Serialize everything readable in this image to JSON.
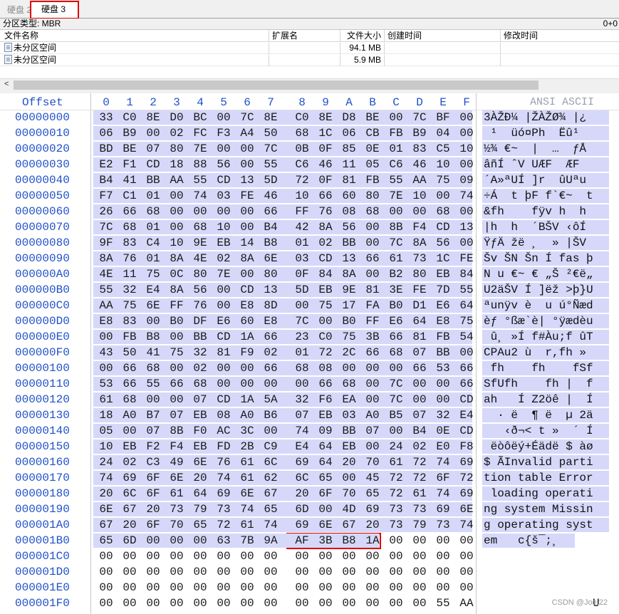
{
  "tabs": [
    {
      "label": "硬盘 2"
    },
    {
      "label": "硬盘 3"
    }
  ],
  "partition_bar": {
    "label": "分区类型: MBR",
    "right_value": "0+0"
  },
  "file_table": {
    "columns": [
      "文件名称",
      "扩展名",
      "文件大小",
      "创建时间",
      "修改时间"
    ],
    "rows": [
      {
        "name": "未分区空间",
        "ext": "",
        "size": "94.1 MB",
        "created": "",
        "modified": ""
      },
      {
        "name": "未分区空间",
        "ext": "",
        "size": "5.9 MB",
        "created": "",
        "modified": ""
      }
    ]
  },
  "hex_view": {
    "offset_header": "Offset",
    "column_headers": [
      "0",
      "1",
      "2",
      "3",
      "4",
      "5",
      "6",
      "7",
      "8",
      "9",
      "A",
      "B",
      "C",
      "D",
      "E",
      "F"
    ],
    "ansi_header": "ANSI ASCII",
    "rows": [
      {
        "offset": "00000000",
        "bytes": [
          "33",
          "C0",
          "8E",
          "D0",
          "BC",
          "00",
          "7C",
          "8E",
          "C0",
          "8E",
          "D8",
          "BE",
          "00",
          "7C",
          "BF",
          "00"
        ],
        "ansi": "3ÀŽÐ¼ |ŽÀŽØ¾ |¿"
      },
      {
        "offset": "00000010",
        "bytes": [
          "06",
          "B9",
          "00",
          "02",
          "FC",
          "F3",
          "A4",
          "50",
          "68",
          "1C",
          "06",
          "CB",
          "FB",
          "B9",
          "04",
          "00"
        ],
        "ansi": " ¹  üó¤Ph  Ëû¹"
      },
      {
        "offset": "00000020",
        "bytes": [
          "BD",
          "BE",
          "07",
          "80",
          "7E",
          "00",
          "00",
          "7C",
          "0B",
          "0F",
          "85",
          "0E",
          "01",
          "83",
          "C5",
          "10"
        ],
        "ansi": "½¾ €~  |  …  ƒÅ"
      },
      {
        "offset": "00000030",
        "bytes": [
          "E2",
          "F1",
          "CD",
          "18",
          "88",
          "56",
          "00",
          "55",
          "C6",
          "46",
          "11",
          "05",
          "C6",
          "46",
          "10",
          "00"
        ],
        "ansi": "âñÍ ˆV UÆF  ÆF"
      },
      {
        "offset": "00000040",
        "bytes": [
          "B4",
          "41",
          "BB",
          "AA",
          "55",
          "CD",
          "13",
          "5D",
          "72",
          "0F",
          "81",
          "FB",
          "55",
          "AA",
          "75",
          "09"
        ],
        "ansi": "´A»ªUÍ ]r  ûUªu"
      },
      {
        "offset": "00000050",
        "bytes": [
          "F7",
          "C1",
          "01",
          "00",
          "74",
          "03",
          "FE",
          "46",
          "10",
          "66",
          "60",
          "80",
          "7E",
          "10",
          "00",
          "74"
        ],
        "ansi": "÷Á  t þF f`€~  t"
      },
      {
        "offset": "00000060",
        "bytes": [
          "26",
          "66",
          "68",
          "00",
          "00",
          "00",
          "00",
          "66",
          "FF",
          "76",
          "08",
          "68",
          "00",
          "00",
          "68",
          "00"
        ],
        "ansi": "&fh    fÿv h  h"
      },
      {
        "offset": "00000070",
        "bytes": [
          "7C",
          "68",
          "01",
          "00",
          "68",
          "10",
          "00",
          "B4",
          "42",
          "8A",
          "56",
          "00",
          "8B",
          "F4",
          "CD",
          "13"
        ],
        "ansi": "|h  h  ´BŠV ‹ôÍ"
      },
      {
        "offset": "00000080",
        "bytes": [
          "9F",
          "83",
          "C4",
          "10",
          "9E",
          "EB",
          "14",
          "B8",
          "01",
          "02",
          "BB",
          "00",
          "7C",
          "8A",
          "56",
          "00"
        ],
        "ansi": "ŸƒÄ žë ¸  » |ŠV"
      },
      {
        "offset": "00000090",
        "bytes": [
          "8A",
          "76",
          "01",
          "8A",
          "4E",
          "02",
          "8A",
          "6E",
          "03",
          "CD",
          "13",
          "66",
          "61",
          "73",
          "1C",
          "FE"
        ],
        "ansi": "Šv ŠN Šn Í fas þ"
      },
      {
        "offset": "000000A0",
        "bytes": [
          "4E",
          "11",
          "75",
          "0C",
          "80",
          "7E",
          "00",
          "80",
          "0F",
          "84",
          "8A",
          "00",
          "B2",
          "80",
          "EB",
          "84"
        ],
        "ansi": "N u €~ € „Š ²€ë„"
      },
      {
        "offset": "000000B0",
        "bytes": [
          "55",
          "32",
          "E4",
          "8A",
          "56",
          "00",
          "CD",
          "13",
          "5D",
          "EB",
          "9E",
          "81",
          "3E",
          "FE",
          "7D",
          "55"
        ],
        "ansi": "U2äŠV Í ]ëž >þ}U"
      },
      {
        "offset": "000000C0",
        "bytes": [
          "AA",
          "75",
          "6E",
          "FF",
          "76",
          "00",
          "E8",
          "8D",
          "00",
          "75",
          "17",
          "FA",
          "B0",
          "D1",
          "E6",
          "64"
        ],
        "ansi": "ªunÿv è  u ú°Ñæd"
      },
      {
        "offset": "000000D0",
        "bytes": [
          "E8",
          "83",
          "00",
          "B0",
          "DF",
          "E6",
          "60",
          "E8",
          "7C",
          "00",
          "B0",
          "FF",
          "E6",
          "64",
          "E8",
          "75"
        ],
        "ansi": "èƒ °ßæ`è| °ÿædèu"
      },
      {
        "offset": "000000E0",
        "bytes": [
          "00",
          "FB",
          "B8",
          "00",
          "BB",
          "CD",
          "1A",
          "66",
          "23",
          "C0",
          "75",
          "3B",
          "66",
          "81",
          "FB",
          "54"
        ],
        "ansi": " û¸ »Í f#Àu;f ûT"
      },
      {
        "offset": "000000F0",
        "bytes": [
          "43",
          "50",
          "41",
          "75",
          "32",
          "81",
          "F9",
          "02",
          "01",
          "72",
          "2C",
          "66",
          "68",
          "07",
          "BB",
          "00"
        ],
        "ansi": "CPAu2 ù  r,fh »"
      },
      {
        "offset": "00000100",
        "bytes": [
          "00",
          "66",
          "68",
          "00",
          "02",
          "00",
          "00",
          "66",
          "68",
          "08",
          "00",
          "00",
          "00",
          "66",
          "53",
          "66"
        ],
        "ansi": " fh    fh    fSf"
      },
      {
        "offset": "00000110",
        "bytes": [
          "53",
          "66",
          "55",
          "66",
          "68",
          "00",
          "00",
          "00",
          "00",
          "66",
          "68",
          "00",
          "7C",
          "00",
          "00",
          "66"
        ],
        "ansi": "SfUfh    fh |  f"
      },
      {
        "offset": "00000120",
        "bytes": [
          "61",
          "68",
          "00",
          "00",
          "07",
          "CD",
          "1A",
          "5A",
          "32",
          "F6",
          "EA",
          "00",
          "7C",
          "00",
          "00",
          "CD"
        ],
        "ansi": "ah   Í Z2öê |  Í"
      },
      {
        "offset": "00000130",
        "bytes": [
          "18",
          "A0",
          "B7",
          "07",
          "EB",
          "08",
          "A0",
          "B6",
          "07",
          "EB",
          "03",
          "A0",
          "B5",
          "07",
          "32",
          "E4"
        ],
        "ansi": "  · ë  ¶ ë  µ 2ä"
      },
      {
        "offset": "00000140",
        "bytes": [
          "05",
          "00",
          "07",
          "8B",
          "F0",
          "AC",
          "3C",
          "00",
          "74",
          "09",
          "BB",
          "07",
          "00",
          "B4",
          "0E",
          "CD"
        ],
        "ansi": "   ‹ð¬< t »  ´ Í"
      },
      {
        "offset": "00000150",
        "bytes": [
          "10",
          "EB",
          "F2",
          "F4",
          "EB",
          "FD",
          "2B",
          "C9",
          "E4",
          "64",
          "EB",
          "00",
          "24",
          "02",
          "E0",
          "F8"
        ],
        "ansi": " ëòôëý+Éädë $ àø"
      },
      {
        "offset": "00000160",
        "bytes": [
          "24",
          "02",
          "C3",
          "49",
          "6E",
          "76",
          "61",
          "6C",
          "69",
          "64",
          "20",
          "70",
          "61",
          "72",
          "74",
          "69"
        ],
        "ansi": "$ ÃInvalid parti"
      },
      {
        "offset": "00000170",
        "bytes": [
          "74",
          "69",
          "6F",
          "6E",
          "20",
          "74",
          "61",
          "62",
          "6C",
          "65",
          "00",
          "45",
          "72",
          "72",
          "6F",
          "72"
        ],
        "ansi": "tion table Error"
      },
      {
        "offset": "00000180",
        "bytes": [
          "20",
          "6C",
          "6F",
          "61",
          "64",
          "69",
          "6E",
          "67",
          "20",
          "6F",
          "70",
          "65",
          "72",
          "61",
          "74",
          "69"
        ],
        "ansi": " loading operati"
      },
      {
        "offset": "00000190",
        "bytes": [
          "6E",
          "67",
          "20",
          "73",
          "79",
          "73",
          "74",
          "65",
          "6D",
          "00",
          "4D",
          "69",
          "73",
          "73",
          "69",
          "6E"
        ],
        "ansi": "ng system Missin"
      },
      {
        "offset": "000001A0",
        "bytes": [
          "67",
          "20",
          "6F",
          "70",
          "65",
          "72",
          "61",
          "74",
          "69",
          "6E",
          "67",
          "20",
          "73",
          "79",
          "73",
          "74"
        ],
        "ansi": "g operating syst"
      },
      {
        "offset": "000001B0",
        "bytes": [
          "65",
          "6D",
          "00",
          "00",
          "00",
          "63",
          "7B",
          "9A",
          "AF",
          "3B",
          "B8",
          "1A",
          "00",
          "00",
          "00",
          "00"
        ],
        "ansi": "em   c{š¯;¸"
      },
      {
        "offset": "000001C0",
        "bytes": [
          "00",
          "00",
          "00",
          "00",
          "00",
          "00",
          "00",
          "00",
          "00",
          "00",
          "00",
          "00",
          "00",
          "00",
          "00",
          "00"
        ],
        "ansi": ""
      },
      {
        "offset": "000001D0",
        "bytes": [
          "00",
          "00",
          "00",
          "00",
          "00",
          "00",
          "00",
          "00",
          "00",
          "00",
          "00",
          "00",
          "00",
          "00",
          "00",
          "00"
        ],
        "ansi": ""
      },
      {
        "offset": "000001E0",
        "bytes": [
          "00",
          "00",
          "00",
          "00",
          "00",
          "00",
          "00",
          "00",
          "00",
          "00",
          "00",
          "00",
          "00",
          "00",
          "00",
          "00"
        ],
        "ansi": ""
      },
      {
        "offset": "000001F0",
        "bytes": [
          "00",
          "00",
          "00",
          "00",
          "00",
          "00",
          "00",
          "00",
          "00",
          "00",
          "00",
          "00",
          "00",
          "00",
          "55",
          "AA"
        ],
        "ansi": "U"
      }
    ]
  },
  "highlight_color": "#e00000",
  "selection_color": "#d6d8fa",
  "watermark": "CSDN @Joe.22"
}
